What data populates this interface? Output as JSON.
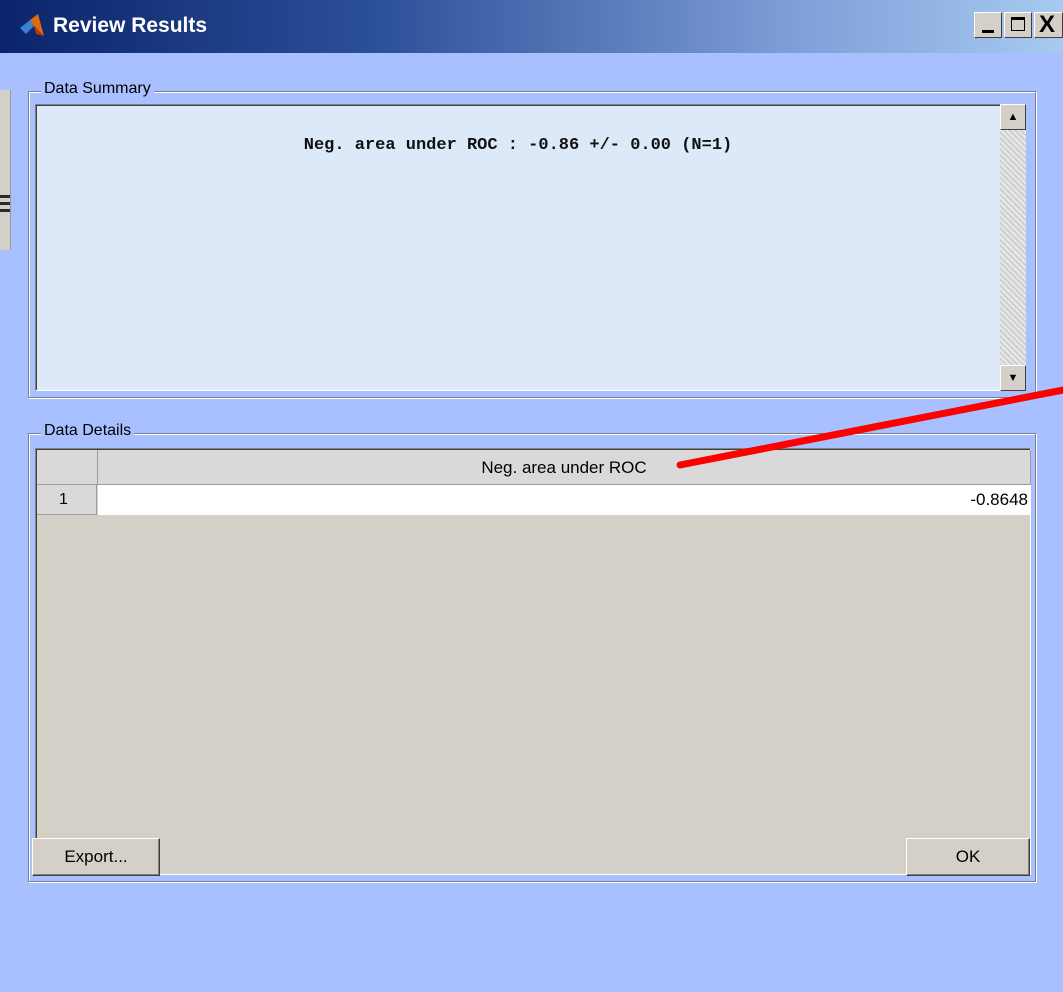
{
  "window": {
    "title": "Review Results",
    "close_glyph": "X"
  },
  "summary": {
    "group_label": "Data Summary",
    "text": "Neg. area under ROC : -0.86 +/- 0.00 (N=1)",
    "scroll_up_glyph": "▲",
    "scroll_down_glyph": "▼"
  },
  "details": {
    "group_label": "Data Details",
    "column_header": "Neg. area under ROC",
    "rows": [
      {
        "index": "1",
        "value": "-0.8648"
      }
    ]
  },
  "buttons": {
    "export_label": "Export...",
    "ok_label": "OK"
  },
  "colors": {
    "dialog_bg": "#a8c0ff",
    "summary_bg": "#dde9f8",
    "annotation": "#ff0000"
  },
  "icons": {
    "app": "matlab-logo-icon",
    "minimize": "minimize-icon",
    "maximize": "maximize-icon",
    "close": "close-icon"
  }
}
